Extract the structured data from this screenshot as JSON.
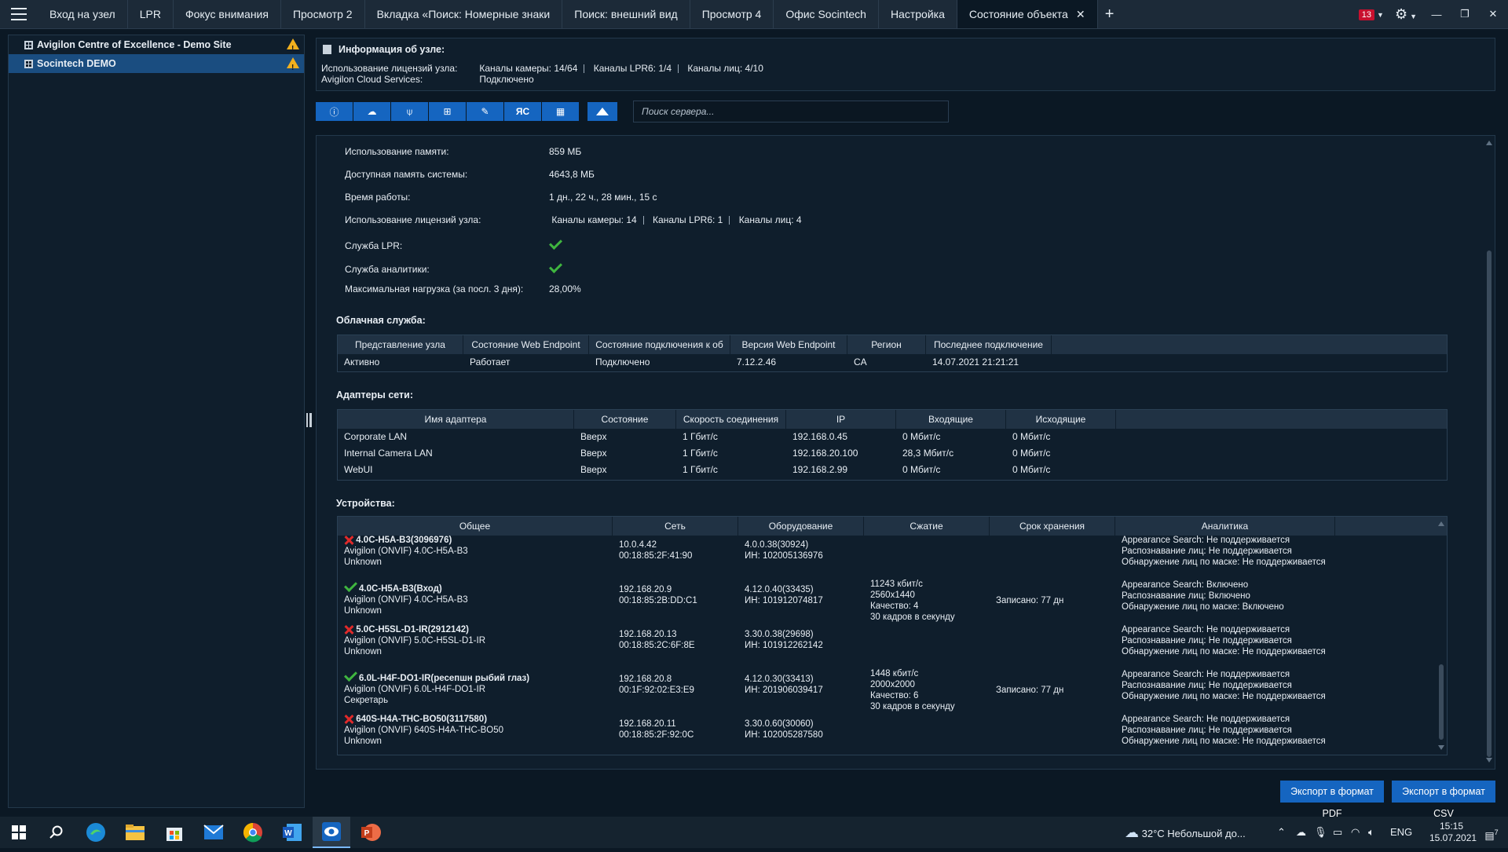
{
  "tabs": [
    {
      "label": "Вход на узел"
    },
    {
      "label": "LPR"
    },
    {
      "label": "Фокус внимания"
    },
    {
      "label": "Просмотр 2"
    },
    {
      "label": "Вкладка «Поиск: Номерные знаки"
    },
    {
      "label": "Поиск: внешний вид"
    },
    {
      "label": "Просмотр 4"
    },
    {
      "label": "Офис Socintech"
    },
    {
      "label": "Настройка"
    },
    {
      "label": "Состояние объекта"
    }
  ],
  "notification_count": "13",
  "sites": [
    {
      "label": "Avigilon Centre of Excellence - Demo Site"
    },
    {
      "label": "Socintech DEMO"
    }
  ],
  "info": {
    "title": "Информация об узле:",
    "license_label": "Использование лицензий узла:",
    "license_camera": "Каналы камеры: 14/64",
    "license_lpr": "Каналы LPR6: 1/4",
    "license_face": "Каналы лиц: 4/10",
    "cloud_label": "Avigilon Cloud Services:",
    "cloud_value": "Подключено"
  },
  "search": {
    "placeholder": "Поиск сервера..."
  },
  "stats": [
    {
      "label": "Использование памяти:",
      "value": "859 МБ"
    },
    {
      "label": "Доступная память системы:",
      "value": "4643,8 МБ"
    },
    {
      "label": "Время работы:",
      "value": "1 дн., 22 ч., 28 мин., 15 с"
    }
  ],
  "license_row": {
    "label": "Использование лицензий узла:",
    "camera": "Каналы камеры: 14",
    "lpr": "Каналы LPR6: 1",
    "face": "Каналы лиц: 4"
  },
  "lpr_service_label": "Служба LPR:",
  "analytics_service_label": "Служба аналитики:",
  "max_load": {
    "label": "Максимальная нагрузка (за посл. 3 дня):",
    "value": "28,00%"
  },
  "cloud": {
    "title": "Облачная служба:",
    "headers": [
      "Представление узла",
      "Состояние Web Endpoint",
      "Состояние подключения к об",
      "Версия Web Endpoint",
      "Регион",
      "Последнее подключение"
    ],
    "row": [
      "Активно",
      "Работает",
      "Подключено",
      "7.12.2.46",
      "CA",
      "14.07.2021 21:21:21"
    ]
  },
  "adapters": {
    "title": "Адаптеры сети:",
    "headers": [
      "Имя адаптера",
      "Состояние",
      "Скорость соединения",
      "IP",
      "Входящие",
      "Исходящие"
    ],
    "rows": [
      [
        "Corporate LAN",
        "Вверх",
        "1 Гбит/с",
        "192.168.0.45",
        "0 Мбит/с",
        "0 Мбит/с"
      ],
      [
        "Internal Camera LAN",
        "Вверх",
        "1 Гбит/с",
        "192.168.20.100",
        "28,3 Мбит/с",
        "0 Мбит/с"
      ],
      [
        "WebUI",
        "Вверх",
        "1 Гбит/с",
        "192.168.2.99",
        "0 Мбит/с",
        "0 Мбит/с"
      ]
    ]
  },
  "devices": {
    "title": "Устройства:",
    "headers": [
      "Общее",
      "Сеть",
      "Оборудование",
      "Сжатие",
      "Срок хранения",
      "Аналитика"
    ],
    "rows": [
      {
        "status": "error",
        "name": "4.0C-H5A-B3(3096976)",
        "model": "Avigilon (ONVIF) 4.0C-H5A-B3",
        "location": "Unknown",
        "ip": "10.0.4.42",
        "mac": "00:18:85:2F:41:90",
        "fw": "4.0.0.38(30924)",
        "sn": "ИН: 102005136976",
        "comp1": "",
        "comp2": "",
        "comp3": "",
        "comp4": "",
        "retention": "",
        "an1": "Appearance Search: Не поддерживается",
        "an2": "Распознавание лиц: Не поддерживается",
        "an3": "Обнаружение лиц по маске: Не поддерживается"
      },
      {
        "status": "ok",
        "name": "4.0C-H5A-B3(Вход)",
        "model": "Avigilon (ONVIF) 4.0C-H5A-B3",
        "location": "Unknown",
        "ip": "192.168.20.9",
        "mac": "00:18:85:2B:DD:C1",
        "fw": "4.12.0.40(33435)",
        "sn": "ИН: 101912074817",
        "comp1": "11243 кбит/с",
        "comp2": "2560x1440",
        "comp3": "Качество: 4",
        "comp4": "30 кадров в секунду",
        "retention": "Записано: 77 дн",
        "an1": "Appearance Search: Включено",
        "an2": "Распознавание лиц: Включено",
        "an3": "Обнаружение лиц по маске: Включено"
      },
      {
        "status": "error",
        "name": "5.0C-H5SL-D1-IR(2912142)",
        "model": "Avigilon (ONVIF) 5.0C-H5SL-D1-IR",
        "location": "Unknown",
        "ip": "192.168.20.13",
        "mac": "00:18:85:2C:6F:8E",
        "fw": "3.30.0.38(29698)",
        "sn": "ИН: 101912262142",
        "comp1": "",
        "comp2": "",
        "comp3": "",
        "comp4": "",
        "retention": "",
        "an1": "Appearance Search: Не поддерживается",
        "an2": "Распознавание лиц: Не поддерживается",
        "an3": "Обнаружение лиц по маске: Не поддерживается"
      },
      {
        "status": "ok",
        "name": "6.0L-H4F-DO1-IR(ресепшн рыбий глаз)",
        "model": "Avigilon (ONVIF) 6.0L-H4F-DO1-IR",
        "location": "Секретарь",
        "ip": "192.168.20.8",
        "mac": "00:1F:92:02:E3:E9",
        "fw": "4.12.0.30(33413)",
        "sn": "ИН: 201906039417",
        "comp1": "1448 кбит/с",
        "comp2": "2000x2000",
        "comp3": "Качество: 6",
        "comp4": "30 кадров в секунду",
        "retention": "Записано: 77 дн",
        "an1": "Appearance Search: Не поддерживается",
        "an2": "Распознавание лиц: Не поддерживается",
        "an3": "Обнаружение лиц по маске: Не поддерживается"
      },
      {
        "status": "error",
        "name": "640S-H4A-THC-BO50(3117580)",
        "model": "Avigilon (ONVIF) 640S-H4A-THC-BO50",
        "location": "Unknown",
        "ip": "192.168.20.11",
        "mac": "00:18:85:2F:92:0C",
        "fw": "3.30.0.60(30060)",
        "sn": "ИН: 102005287580",
        "comp1": "",
        "comp2": "",
        "comp3": "",
        "comp4": "",
        "retention": "",
        "an1": "Appearance Search: Не поддерживается",
        "an2": "Распознавание лиц: Не поддерживается",
        "an3": "Обнаружение лиц по маске: Не поддерживается"
      }
    ]
  },
  "export": {
    "pdf": "Экспорт в формат PDF",
    "csv": "Экспорт в формат CSV"
  },
  "taskbar": {
    "weather": "32°C  Небольшой до...",
    "lang": "ENG",
    "time": "15:15",
    "date": "15.07.2021",
    "notif_count": "7"
  },
  "colors": {
    "accent": "#1565c0",
    "selected": "#1a4d80",
    "ok": "#3fb53f",
    "error": "#e02a2a",
    "warning": "#f2b01e"
  }
}
